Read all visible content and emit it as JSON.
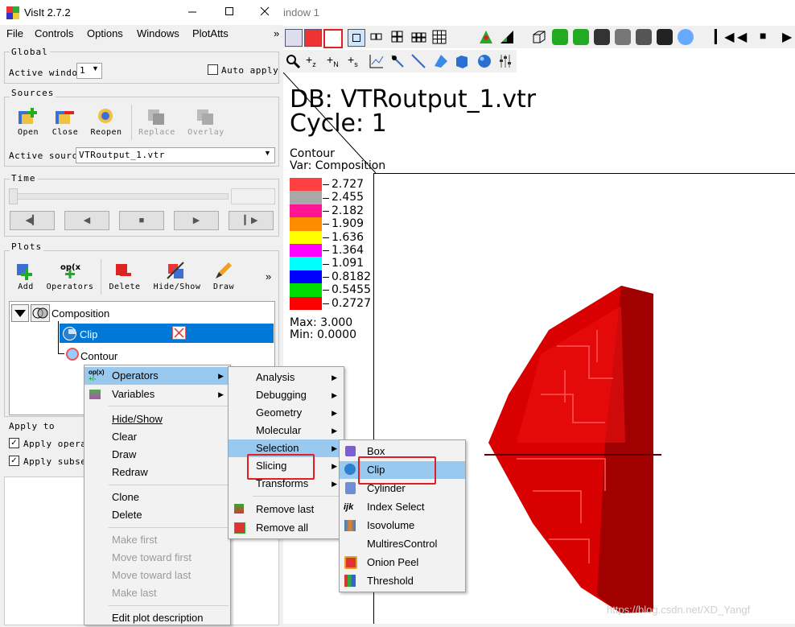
{
  "control_window": {
    "title": "VisIt 2.7.2",
    "menu": [
      "File",
      "Controls",
      "Options",
      "Windows",
      "PlotAtts"
    ],
    "menu_more": "»",
    "global": {
      "label": "Global",
      "active_window_label": "Active window",
      "active_window_value": "1",
      "auto_apply_label": "Auto apply"
    },
    "sources": {
      "label": "Sources",
      "buttons": [
        "Open",
        "Close",
        "Reopen",
        "Replace",
        "Overlay"
      ],
      "active_source_label": "Active source",
      "active_source_value": "VTRoutput_1.vtr"
    },
    "time": {
      "label": "Time"
    },
    "plots": {
      "label": "Plots",
      "buttons": [
        "Add",
        "Operators",
        "Delete",
        "Hide/Show",
        "Draw"
      ],
      "more": "»",
      "tree": [
        {
          "label": "Composition"
        },
        {
          "label": "Clip"
        },
        {
          "label": "Contour"
        }
      ]
    },
    "apply_to": {
      "label": "Apply to",
      "items": [
        "Apply operato",
        "Apply subset"
      ]
    }
  },
  "viz_window": {
    "title_fragment": "indow 1",
    "db": "DB: VTRoutput_1.vtr",
    "cycle": "Cycle: 1",
    "plot_name": "Contour",
    "var": "Var: Composition",
    "legend": {
      "entries": [
        {
          "value": "2.727",
          "color": "#ff4040"
        },
        {
          "value": "2.455",
          "color": "#a8a8a8"
        },
        {
          "value": "2.182",
          "color": "#ff1493"
        },
        {
          "value": "1.909",
          "color": "#ff8c00"
        },
        {
          "value": "1.636",
          "color": "#ffff00"
        },
        {
          "value": "1.364",
          "color": "#ff00ff"
        },
        {
          "value": "1.091",
          "color": "#00ffff"
        },
        {
          "value": "0.8182",
          "color": "#0000ff"
        },
        {
          "value": "0.5455",
          "color": "#00dd00"
        },
        {
          "value": "0.2727",
          "color": "#ff0000"
        }
      ],
      "max": "Max:  3.000",
      "min": "Min:  0.0000"
    },
    "watermark": "https://blog.csdn.net/XD_Yangf",
    "object_color": "#e00000"
  },
  "context_menu": {
    "items": [
      "Operators",
      "Variables",
      "Hide/Show",
      "Clear",
      "Draw",
      "Redraw",
      "Clone",
      "Delete",
      "Make first",
      "Move toward first",
      "Move toward last",
      "Make last",
      "Edit plot description"
    ]
  },
  "operators_menu": {
    "items": [
      "Analysis",
      "Debugging",
      "Geometry",
      "Molecular",
      "Selection",
      "Slicing",
      "Transforms",
      "Remove last",
      "Remove all"
    ]
  },
  "selection_menu": {
    "items": [
      "Box",
      "Clip",
      "Cylinder",
      "Index Select",
      "Isovolume",
      "MultiresControl",
      "Onion Peel",
      "Threshold"
    ]
  }
}
